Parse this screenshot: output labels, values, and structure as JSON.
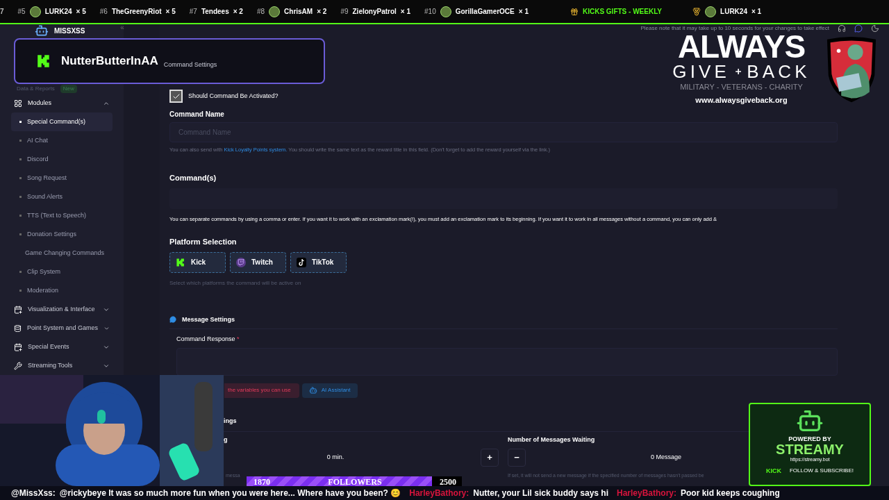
{
  "ticker": {
    "lead": "7",
    "items": [
      {
        "rank": "#5",
        "name": "LURK24",
        "count": "× 5",
        "avatar": true
      },
      {
        "rank": "#6",
        "name": "TheGreenyRiot",
        "count": "× 5",
        "avatar": false
      },
      {
        "rank": "#7",
        "name": "Tendees",
        "count": "× 2",
        "avatar": false
      },
      {
        "rank": "#8",
        "name": "ChrisAM",
        "count": "× 2",
        "avatar": true
      },
      {
        "rank": "#9",
        "name": "ZielonyPatrol",
        "count": "× 1",
        "avatar": false
      },
      {
        "rank": "#10",
        "name": "GorillaGamerOCE",
        "count": "× 1",
        "avatar": true
      }
    ],
    "gifts_title": "KICKS GIFTS - WEEKLY",
    "gift_top": {
      "name": "LURK24",
      "count": "× 1"
    }
  },
  "app": {
    "brand": "MISSXSS",
    "collapse": "«",
    "notice": "Please note that it may take up to 10 seconds for your changes to take effect"
  },
  "overlay_user": {
    "name": "NutterButterInAA"
  },
  "breadcrumb": "Command Settings",
  "sidebar": {
    "data_reports": {
      "label": "Data & Reports",
      "badge": "New"
    },
    "groups": [
      {
        "label": "Modules",
        "expanded": true,
        "children": [
          {
            "label": "Special Command(s)",
            "selected": true
          },
          {
            "label": "AI Chat",
            "selected": false
          },
          {
            "label": "Discord",
            "selected": false
          },
          {
            "label": "Song Request",
            "selected": false
          },
          {
            "label": "Sound Alerts",
            "selected": false
          },
          {
            "label": "TTS (Text to Speech)",
            "selected": false
          },
          {
            "label": "Donation Settings",
            "selected": false
          },
          {
            "label": "Game Changing Commands",
            "selected": false
          },
          {
            "label": "Clip System",
            "selected": false
          },
          {
            "label": "Moderation",
            "selected": false
          }
        ]
      },
      {
        "label": "Visualization & Interface",
        "expanded": false
      },
      {
        "label": "Point System and Games",
        "expanded": false
      },
      {
        "label": "Special Events",
        "expanded": false
      },
      {
        "label": "Streaming Tools",
        "expanded": false
      }
    ]
  },
  "form": {
    "activate": {
      "label": "Should Command Be Activated?",
      "checked": true
    },
    "command_name": {
      "label": "Command Name",
      "placeholder": "Command Name",
      "help_before": "You can also send with ",
      "help_link": "Kick Loyalty Points system.",
      "help_after": " You should write the same text as the reward title in this field. (Don't forget to add the reward yourself via the link.)"
    },
    "commands": {
      "label": "Command(s)",
      "help": "You can separate commands by using a comma or enter. If you want it to work with an exclamation mark(!), you must add an exclamation mark to its beginning. If you want it to work in all messages without a command, you can only add &"
    },
    "platforms": {
      "label": "Platform Selection",
      "items": [
        {
          "kind": "kick",
          "label": "Kick"
        },
        {
          "kind": "twitch",
          "label": "Twitch"
        },
        {
          "kind": "tiktok",
          "label": "TikTok"
        }
      ],
      "hint": "Select which platforms the command will be active on"
    },
    "message_settings": {
      "title": "Message Settings",
      "response_label": "Command Response",
      "required": "*",
      "variables_button": "the variables you can use",
      "ai_button": "AI Assistant"
    },
    "timing": {
      "heading": "ings",
      "left_label": "g",
      "left_value": "0 min.",
      "plus": "+",
      "left_hint": "messa",
      "right_label": "Number of Messages Waiting",
      "minus": "−",
      "right_value": "0 Message",
      "right_hint": "If set, it will not send a new message if the specified number of messages hasn't passed be"
    }
  },
  "logo": {
    "line1": "ALWAYS",
    "line2a": "GIVE",
    "line2b": "BACK",
    "tagline": "MILITARY - VETERANS - CHARITY",
    "url": "www.alwaysgiveback.org"
  },
  "followers": {
    "current": "1870",
    "label": "FOLLOWERS",
    "goal": "2500",
    "level": 0.86
  },
  "streamy": {
    "powered": "POWERED BY",
    "name": "STREAMY",
    "url": "https://streamy.bot",
    "kick": "KICK",
    "cta": "FOLLOW & SUBSCRIBE!"
  },
  "chat": [
    {
      "user": "@MissXss:",
      "text": "@rickybeye It was so much more fun when you were here... Where have you been? 😊",
      "color": "#ffffff"
    },
    {
      "user": "HarleyBathory:",
      "text": "Nutter, your Lil sick buddy says hi",
      "color": "#d8143c"
    },
    {
      "user": "HarleyBathory:",
      "text": "Poor kid keeps coughing",
      "color": "#d8143c"
    }
  ]
}
